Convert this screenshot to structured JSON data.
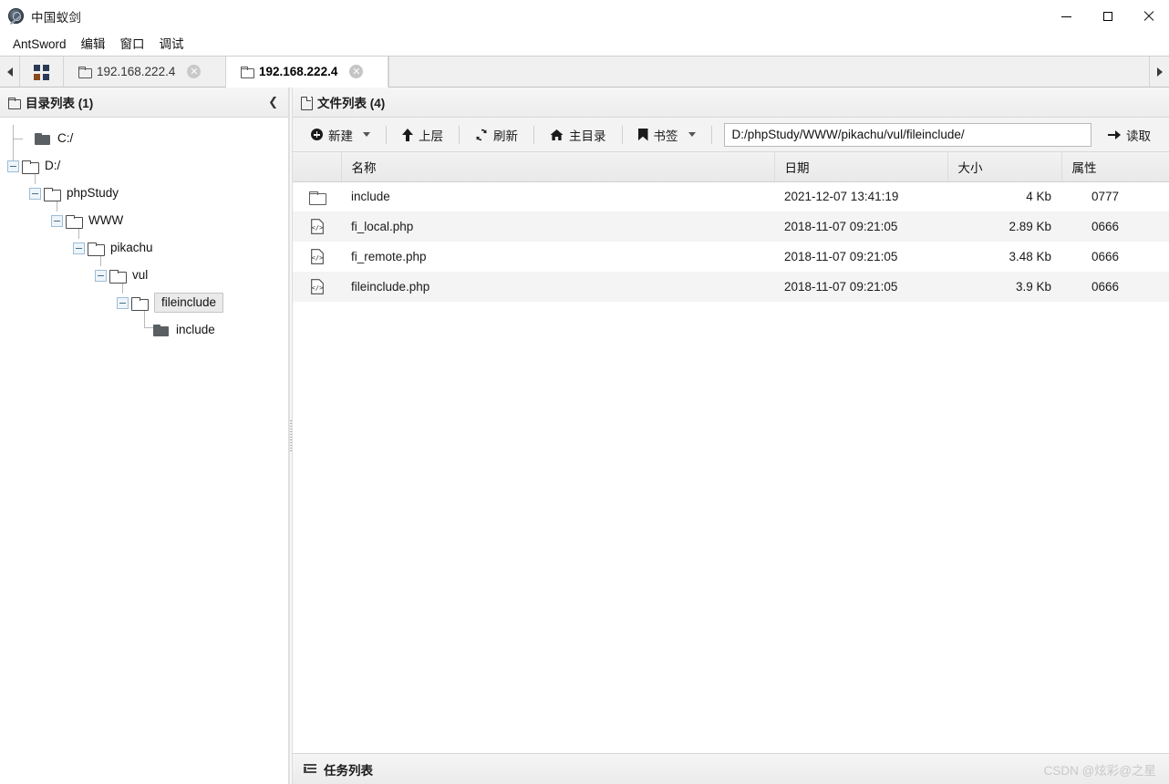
{
  "window": {
    "title": "中国蚁剑",
    "logo_icon": "antsword-logo-icon",
    "minimize_label": "minimize",
    "maximize_label": "maximize",
    "close_label": "close"
  },
  "menubar": {
    "items": [
      {
        "label": "AntSword"
      },
      {
        "label": "编辑"
      },
      {
        "label": "窗口"
      },
      {
        "label": "调试"
      }
    ]
  },
  "tabbar": {
    "scroll_left_icon": "chevron-left-icon",
    "scroll_right_icon": "chevron-right-icon",
    "grid_icon": "grid-view-icon",
    "close_glyph": "✕",
    "tabs": [
      {
        "label": "192.168.222.4",
        "active": false
      },
      {
        "label": "192.168.222.4",
        "active": true
      }
    ]
  },
  "sidebar": {
    "title": "目录列表 (1)",
    "header_icon": "folder-icon",
    "collapse_glyph": "❮",
    "tree": [
      {
        "label": "C:/",
        "depth": 0,
        "toggle": "none",
        "icon": "folder-solid-icon",
        "selected": false
      },
      {
        "label": "D:/",
        "depth": 0,
        "toggle": "expanded",
        "icon": "folder-open-icon",
        "selected": false
      },
      {
        "label": "phpStudy",
        "depth": 1,
        "toggle": "expanded",
        "icon": "folder-open-icon",
        "selected": false
      },
      {
        "label": "WWW",
        "depth": 2,
        "toggle": "expanded",
        "icon": "folder-open-icon",
        "selected": false
      },
      {
        "label": "pikachu",
        "depth": 3,
        "toggle": "expanded",
        "icon": "folder-open-icon",
        "selected": false
      },
      {
        "label": "vul",
        "depth": 4,
        "toggle": "expanded",
        "icon": "folder-open-icon",
        "selected": false
      },
      {
        "label": "fileinclude",
        "depth": 5,
        "toggle": "expanded",
        "icon": "folder-open-icon",
        "selected": true
      },
      {
        "label": "include",
        "depth": 6,
        "toggle": "none",
        "icon": "folder-solid-icon",
        "selected": false
      }
    ]
  },
  "filepanel": {
    "title": "文件列表 (4)",
    "header_icon": "document-icon",
    "toolbar": {
      "new_label": "新建",
      "new_icon": "plus-circle-icon",
      "up_label": "上层",
      "up_icon": "arrow-up-icon",
      "refresh_label": "刷新",
      "refresh_icon": "refresh-icon",
      "home_label": "主目录",
      "home_icon": "home-icon",
      "bookmark_label": "书签",
      "bookmark_icon": "bookmark-icon",
      "read_label": "读取",
      "read_icon": "arrow-right-icon"
    },
    "path": {
      "value": "D:/phpStudy/WWW/pikachu/vul/fileinclude/",
      "placeholder": "D:/phpStudy/WWW/pikachu/vul/fileinclude/"
    },
    "table": {
      "columns": [
        "",
        "名称",
        "日期",
        "大小",
        "属性"
      ],
      "rows": [
        {
          "icon": "folder-icon",
          "name": "include",
          "date": "2021-12-07 13:41:19",
          "size": "4 Kb",
          "attr": "0777"
        },
        {
          "icon": "code-file-icon",
          "name": "fi_local.php",
          "date": "2018-11-07 09:21:05",
          "size": "2.89 Kb",
          "attr": "0666"
        },
        {
          "icon": "code-file-icon",
          "name": "fi_remote.php",
          "date": "2018-11-07 09:21:05",
          "size": "3.48 Kb",
          "attr": "0666"
        },
        {
          "icon": "code-file-icon",
          "name": "fileinclude.php",
          "date": "2018-11-07 09:21:05",
          "size": "3.9 Kb",
          "attr": "0666"
        }
      ]
    }
  },
  "statusbar": {
    "tasks_label": "任务列表",
    "tasks_icon": "task-list-icon",
    "watermark": "CSDN @炫彩@之星"
  },
  "colors": {
    "window_bg": "#ffffff",
    "chrome_bg": "#f0f0f0",
    "toolbar_bg": "#f3f3f3",
    "row_alt": "#f4f4f4",
    "border": "#d8d8d8",
    "text": "#1a1a1a",
    "watermark": "#c9c9c9"
  }
}
